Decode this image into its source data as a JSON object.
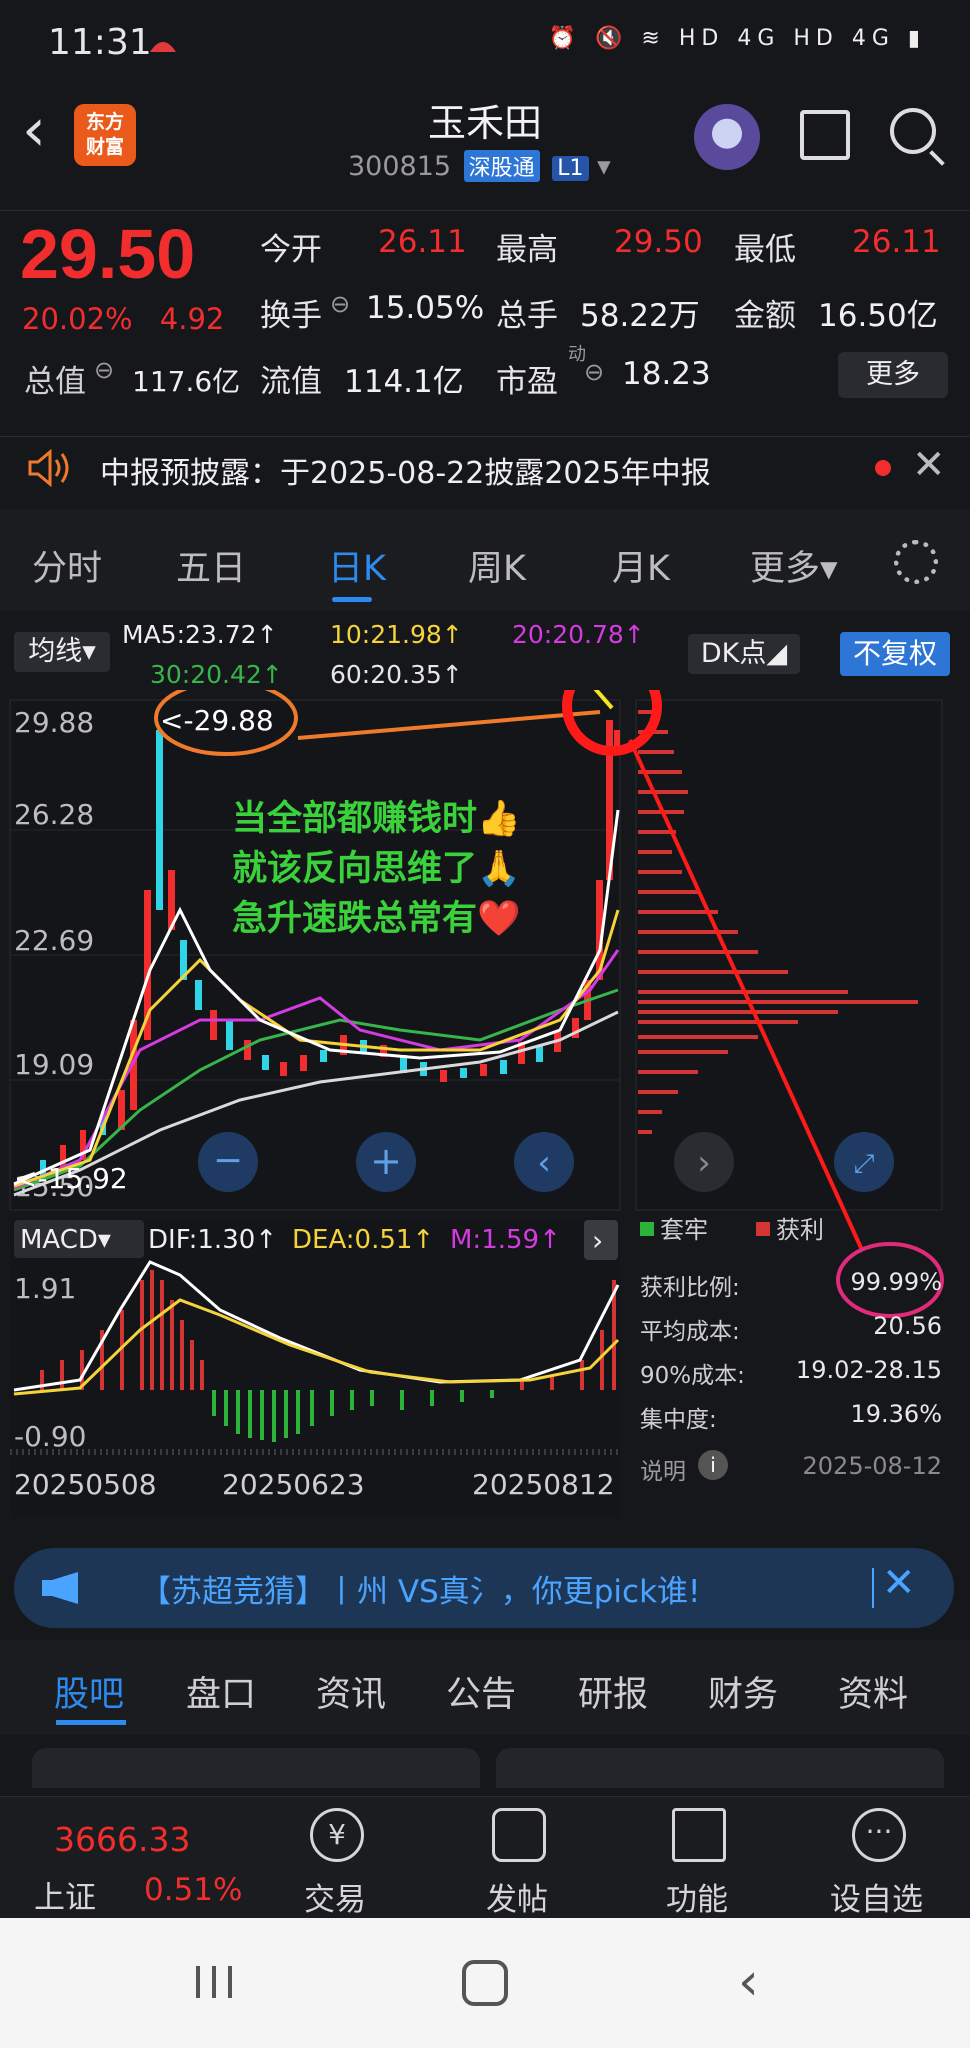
{
  "status_bar": {
    "time": "11:31",
    "right_icons": "⏰ 🔇 ≋ HD 4G HD 4G ▮"
  },
  "header": {
    "back": "‹",
    "logo_line1": "东方",
    "logo_line2": "财富",
    "stock_name": "玉禾田",
    "stock_code": "300815",
    "tag_connect": "深股通",
    "tag_level": "L1",
    "dropdown": "▾"
  },
  "quote": {
    "price": "29.50",
    "change_pct": "20.02%",
    "change_amt": "4.92",
    "open_label": "今开",
    "open_value": "26.11",
    "high_label": "最高",
    "high_value": "29.50",
    "low_label": "最低",
    "low_value": "26.11",
    "turnover_label": "换手",
    "turnover_value": "15.05%",
    "volume_label": "总手",
    "volume_value": "58.22万",
    "amount_label": "金额",
    "amount_value": "16.50亿",
    "mcap_label": "总值",
    "mcap_value": "117.6亿",
    "float_label": "流值",
    "float_value": "114.1亿",
    "pe_label": "市盈",
    "pe_sup": "动",
    "pe_value": "18.23",
    "more": "更多"
  },
  "notice": {
    "text": "中报预披露：于2025-08-22披露2025年中报",
    "close": "✕"
  },
  "tabs": [
    {
      "label": "分时"
    },
    {
      "label": "五日"
    },
    {
      "label": "日K"
    },
    {
      "label": "周K"
    },
    {
      "label": "月K"
    },
    {
      "label": "更多▾"
    }
  ],
  "chart_header": {
    "indicator": "均线▾",
    "ma5": "MA5:23.72↑",
    "ma10": "10:21.98↑",
    "ma20": "20:20.78↑",
    "ma30": "30:20.42↑",
    "ma60": "60:20.35↑",
    "dk": "DK点◢",
    "adjust": "不复权"
  },
  "kline": {
    "y_ticks": [
      "29.88",
      "26.28",
      "22.69",
      "19.09",
      "15.50"
    ],
    "high_marker": "<-29.88",
    "low_marker": "<-15.92",
    "annotation_lines": [
      "当全部都赚钱时👍",
      "就该反向思维了🙏",
      "急升速跌总常有❤️"
    ]
  },
  "macd": {
    "indicator": "MACD▾",
    "dif": "DIF:1.30↑",
    "dea": "DEA:0.51↑",
    "m": "M:1.59↑",
    "y_top": "1.91",
    "y_bottom": "-0.90",
    "dates": [
      "20250508",
      "20250623",
      "20250812"
    ]
  },
  "chip": {
    "legend_lock": "套牢",
    "legend_profit": "获利",
    "profit_ratio_label": "获利比例:",
    "profit_ratio_value": "99.99%",
    "avg_cost_label": "平均成本:",
    "avg_cost_value": "20.56",
    "cost90_label": "90%成本:",
    "cost90_value": "19.02-28.15",
    "concentration_label": "集中度:",
    "concentration_value": "19.36%",
    "note_label": "说明",
    "date": "2025-08-12"
  },
  "banner": {
    "text": "【苏超竞猜】丨州 VS真氵，你更pick谁!",
    "close": "✕"
  },
  "lower_tabs": [
    {
      "label": "股吧"
    },
    {
      "label": "盘口"
    },
    {
      "label": "资讯"
    },
    {
      "label": "公告"
    },
    {
      "label": "研报"
    },
    {
      "label": "财务"
    },
    {
      "label": "资料"
    }
  ],
  "bottom_nav": {
    "index_value": "3666.33",
    "index_name": "上证",
    "index_change": "0.51%",
    "items": [
      {
        "label": "交易"
      },
      {
        "label": "发帖"
      },
      {
        "label": "功能"
      },
      {
        "label": "设自选"
      }
    ]
  },
  "colors": {
    "up": "#f12d2d",
    "accent": "#2d8bf0",
    "ma5": "#ffffff",
    "ma10": "#f5d33a",
    "ma20": "#d43be0",
    "ma30": "#38b54a",
    "ma60": "#cfcfcf"
  }
}
